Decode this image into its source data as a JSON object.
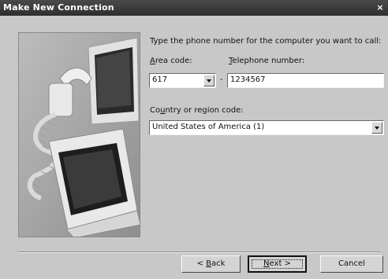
{
  "window": {
    "title": "Make New Connection",
    "close_glyph": "×"
  },
  "instructions": "Type the phone number for the computer you want to call:",
  "area_code": {
    "label_underlined": "A",
    "label_rest": "rea code:",
    "value": "617"
  },
  "separator": "-",
  "telephone": {
    "label_underlined": "T",
    "label_rest": "elephone number:",
    "value": "1234567"
  },
  "country": {
    "label_prefix": "Co",
    "label_underlined": "u",
    "label_rest": "ntry or region code:",
    "value": "United States of America (1)"
  },
  "buttons": {
    "back": {
      "prefix": "< ",
      "underlined": "B",
      "rest": "ack"
    },
    "next": {
      "underlined": "N",
      "rest": "ext >"
    },
    "cancel": {
      "label": "Cancel"
    }
  },
  "icons": {
    "close": "close-icon",
    "dropdown": "chevron-down-icon"
  }
}
